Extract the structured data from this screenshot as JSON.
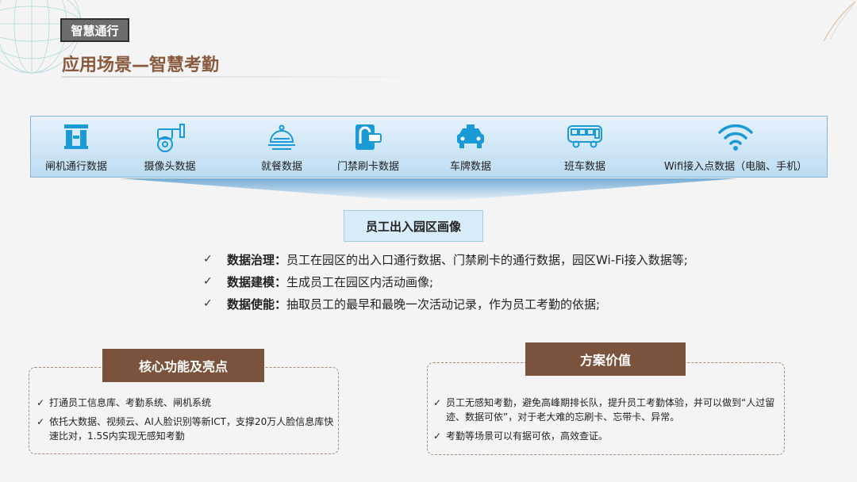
{
  "section_tag": "智慧通行",
  "page_title": "应用场景—智慧考勤",
  "data_sources": [
    {
      "label": "闸机通行数据",
      "icon": "turnstile-icon"
    },
    {
      "label": "摄像头数据",
      "icon": "camera-icon"
    },
    {
      "label": "就餐数据",
      "icon": "dining-cloche-icon"
    },
    {
      "label": "门禁刷卡数据",
      "icon": "access-card-icon"
    },
    {
      "label": "车牌数据",
      "icon": "taxi-icon"
    },
    {
      "label": "班车数据",
      "icon": "bus-icon"
    },
    {
      "label": "Wifi接入点数据（电脑、手机）",
      "icon": "wifi-icon"
    }
  ],
  "portrait_label": "员工出入园区画像",
  "bullets": [
    {
      "key": "数据治理：",
      "text": "员工在园区的出入口通行数据、门禁刷卡的通行数据，园区Wi-Fi接入数据等;"
    },
    {
      "key": "数据建模：",
      "text": "生成员工在园区内活动画像;"
    },
    {
      "key": "数据使能：",
      "text": "抽取员工的最早和最晚一次活动记录，作为员工考勤的依据;"
    }
  ],
  "check_mark": "✓",
  "core_features": {
    "title": "核心功能及亮点",
    "items": [
      "打通员工信息库、考勤系统、闸机系统",
      "依托大数据、视频云、AI人脸识别等新ICT，支撑20万人脸信息库快速比对，1.5S内实现无感知考勤"
    ]
  },
  "solution_value": {
    "title": "方案价值",
    "items": [
      "员工无感知考勤，避免高峰期排长队，提升员工考勤体验，并可以做到“人过留迹、数据可依”，对于老大难的忘刷卡、忘带卡、异常。",
      "考勤等场景可以有据可依，高效查证。"
    ]
  },
  "colors": {
    "brand_brown": "#7b533c",
    "title_brown": "#8a5a3f",
    "icon_blue": "#1a9ad6",
    "band_light": "#e6f2fb"
  }
}
